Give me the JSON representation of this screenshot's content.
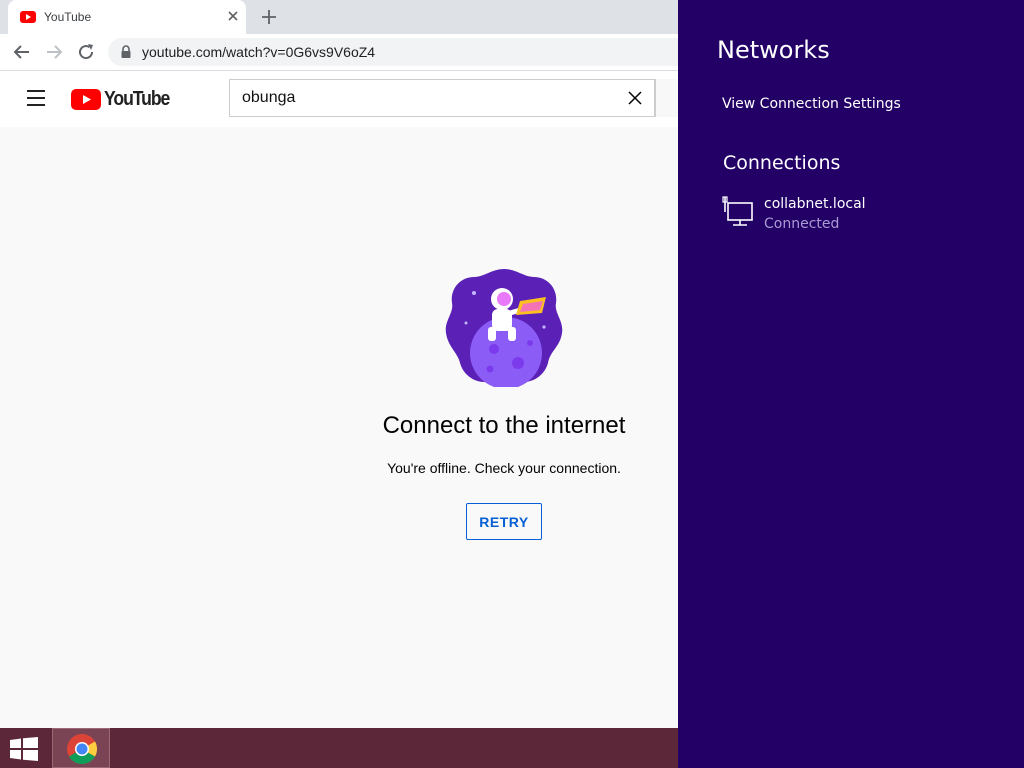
{
  "browser": {
    "tab_title": "YouTube",
    "url": "youtube.com/watch?v=0G6vs9V6oZ4"
  },
  "youtube": {
    "logo_text": "YouTube",
    "search_value": "obunga",
    "offline_title": "Connect to the internet",
    "offline_subtitle": "You're offline. Check your connection.",
    "retry_label": "RETRY",
    "brand_red": "#ff0000",
    "link_blue": "#065fd4"
  },
  "networks": {
    "title": "Networks",
    "view_settings_label": "View Connection Settings",
    "connections_heading": "Connections",
    "connection": {
      "name": "collabnet.local",
      "status": "Connected",
      "icon": "wired-network-icon"
    },
    "panel_color": "#220066"
  },
  "taskbar": {
    "color": "#5c2738",
    "apps": [
      {
        "name": "start-button",
        "icon": "windows-logo-icon"
      },
      {
        "name": "chrome-taskbar-button",
        "icon": "chrome-icon"
      }
    ]
  }
}
